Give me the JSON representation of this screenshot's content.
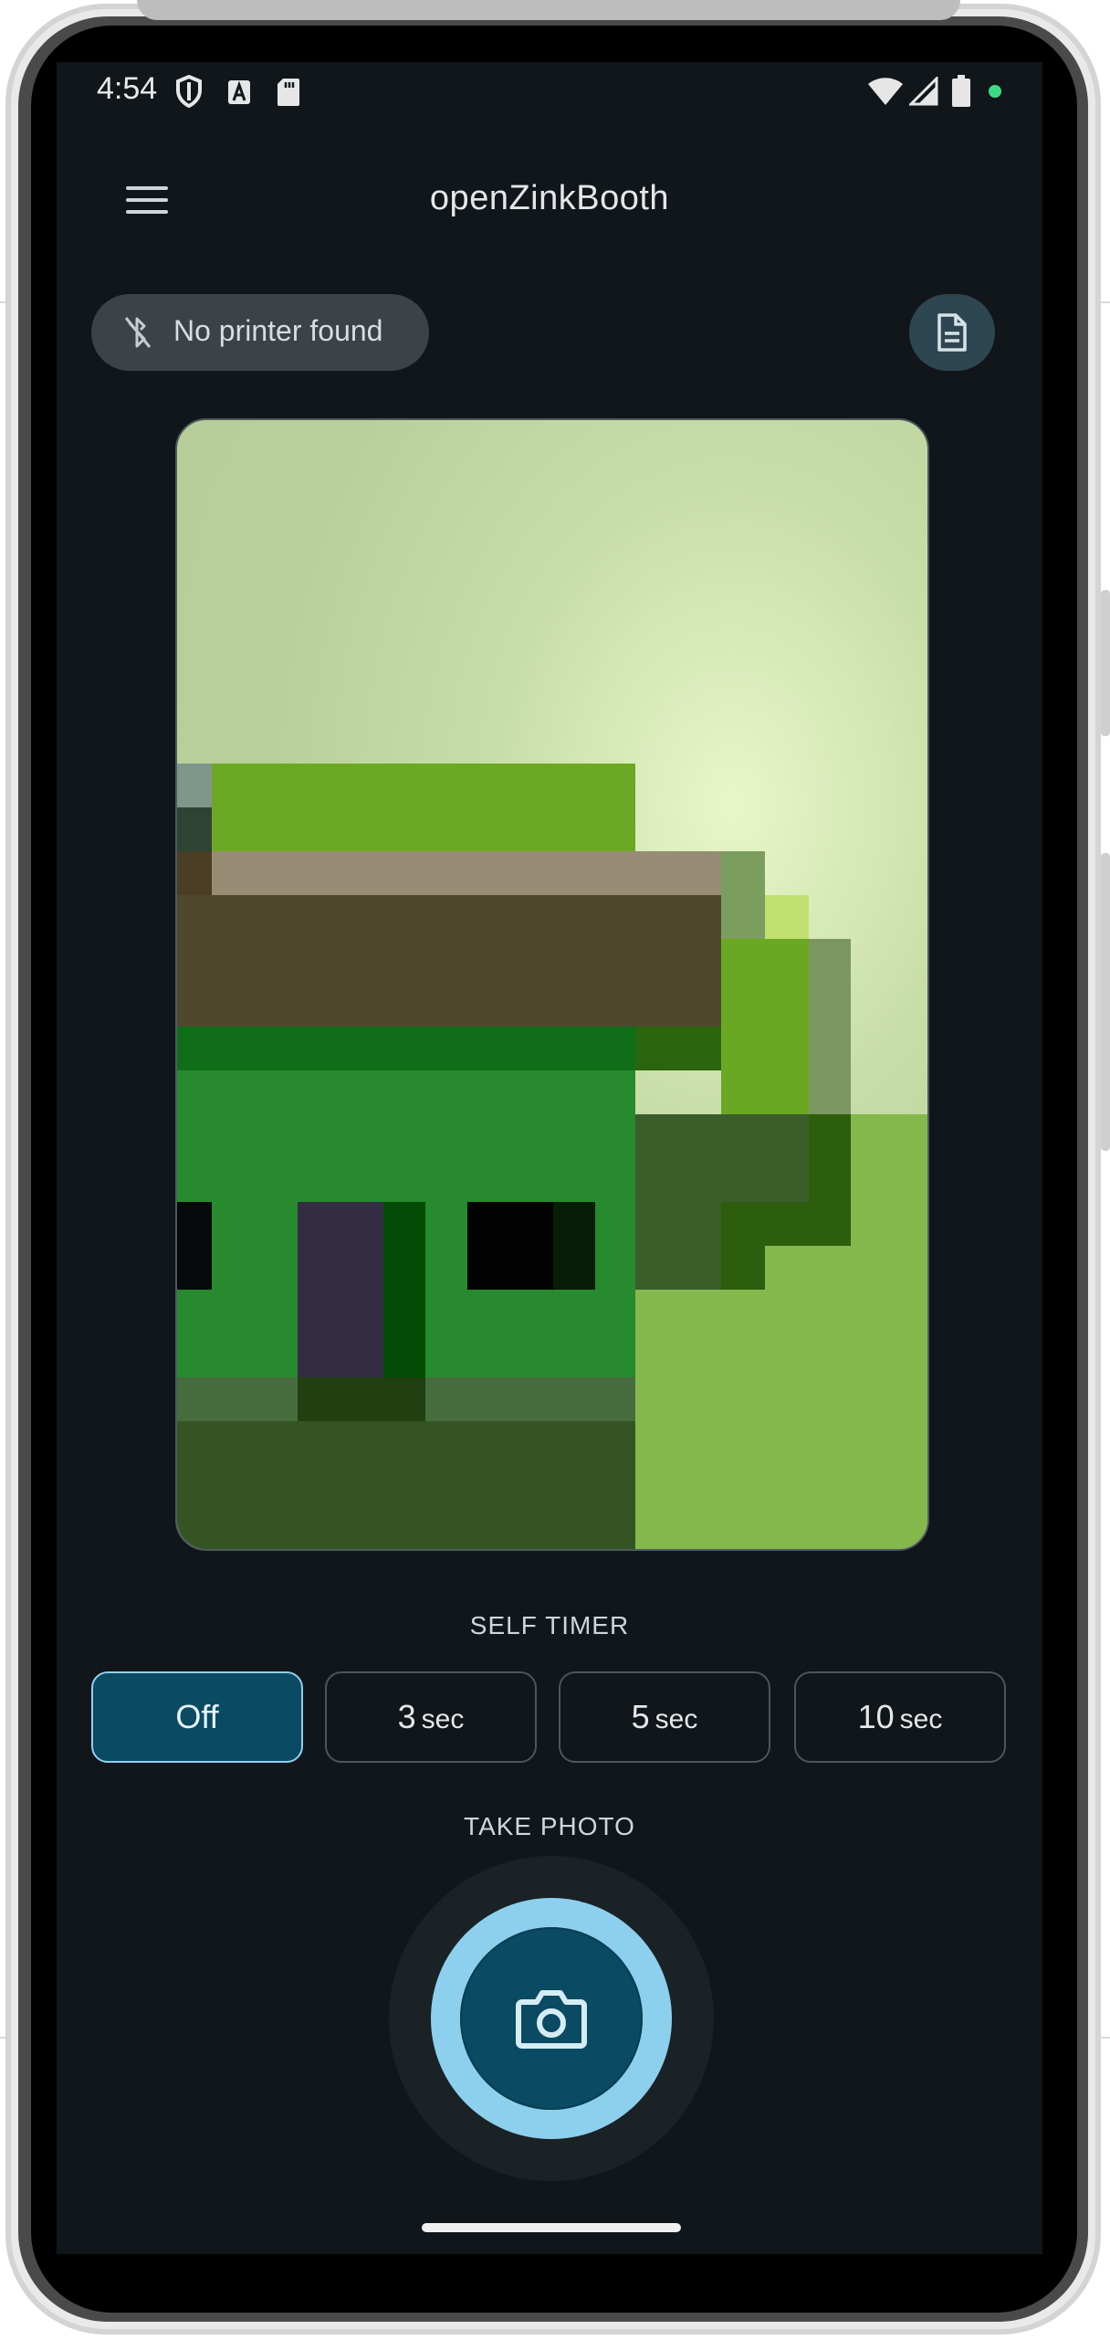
{
  "status_bar": {
    "time": "4:54",
    "icons": [
      "shield-icon",
      "font-a-icon",
      "sd-card-icon",
      "wifi-icon",
      "signal-icon",
      "battery-icon",
      "active-dot-icon"
    ]
  },
  "app_bar": {
    "title": "openZinkBooth",
    "menu_icon": "menu-icon"
  },
  "printer_status": {
    "label": "No printer found",
    "icon": "bluetooth-disabled-icon"
  },
  "document_button": {
    "icon": "document-icon"
  },
  "self_timer": {
    "label": "SELF TIMER",
    "options": [
      {
        "value": "Off",
        "unit": ""
      },
      {
        "value": "3",
        "unit": "sec"
      },
      {
        "value": "5",
        "unit": "sec"
      },
      {
        "value": "10",
        "unit": "sec"
      }
    ],
    "selected": "Off"
  },
  "take_photo": {
    "label": "TAKE PHOTO",
    "icon": "camera-icon"
  },
  "colors": {
    "background": "#11161a",
    "accent": "#8dd0ee",
    "accent_dark": "#0a4a62",
    "chip": "#3b4348"
  }
}
